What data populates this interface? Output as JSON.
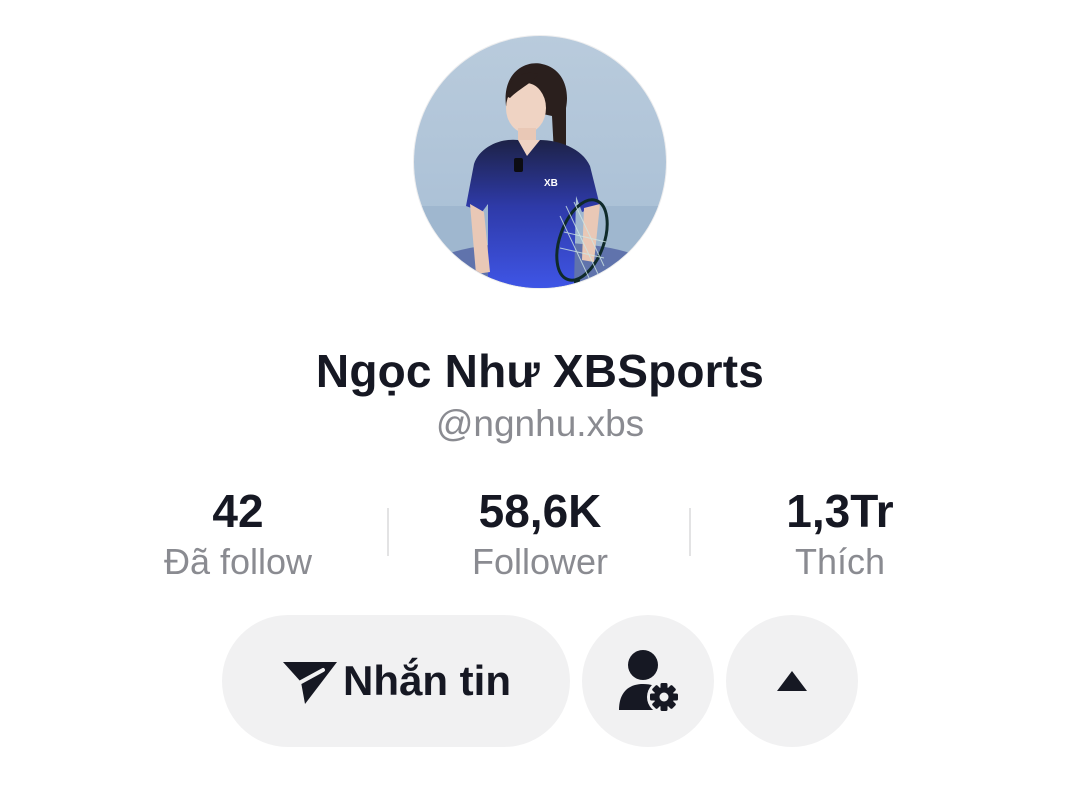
{
  "header": {
    "back_icon": "chevron-left-icon",
    "more_icon": "more-icon"
  },
  "profile": {
    "display_name": "Ngọc Như XBSports",
    "username": "@ngnhu.xbs",
    "avatar_icon": "profile-photo"
  },
  "stats": {
    "following": {
      "value": "42",
      "label": "Đã follow"
    },
    "followers": {
      "value": "58,6K",
      "label": "Follower"
    },
    "likes": {
      "value": "1,3Tr",
      "label": "Thích"
    }
  },
  "actions": {
    "message_label": "Nhắn tin",
    "message_icon": "send-icon",
    "friends_icon": "user-settings-icon",
    "more_icon": "caret-up-icon"
  },
  "colors": {
    "text_primary": "#161823",
    "text_secondary": "#8a8b91",
    "button_bg": "#f1f1f2",
    "divider": "#e3e3e4"
  }
}
